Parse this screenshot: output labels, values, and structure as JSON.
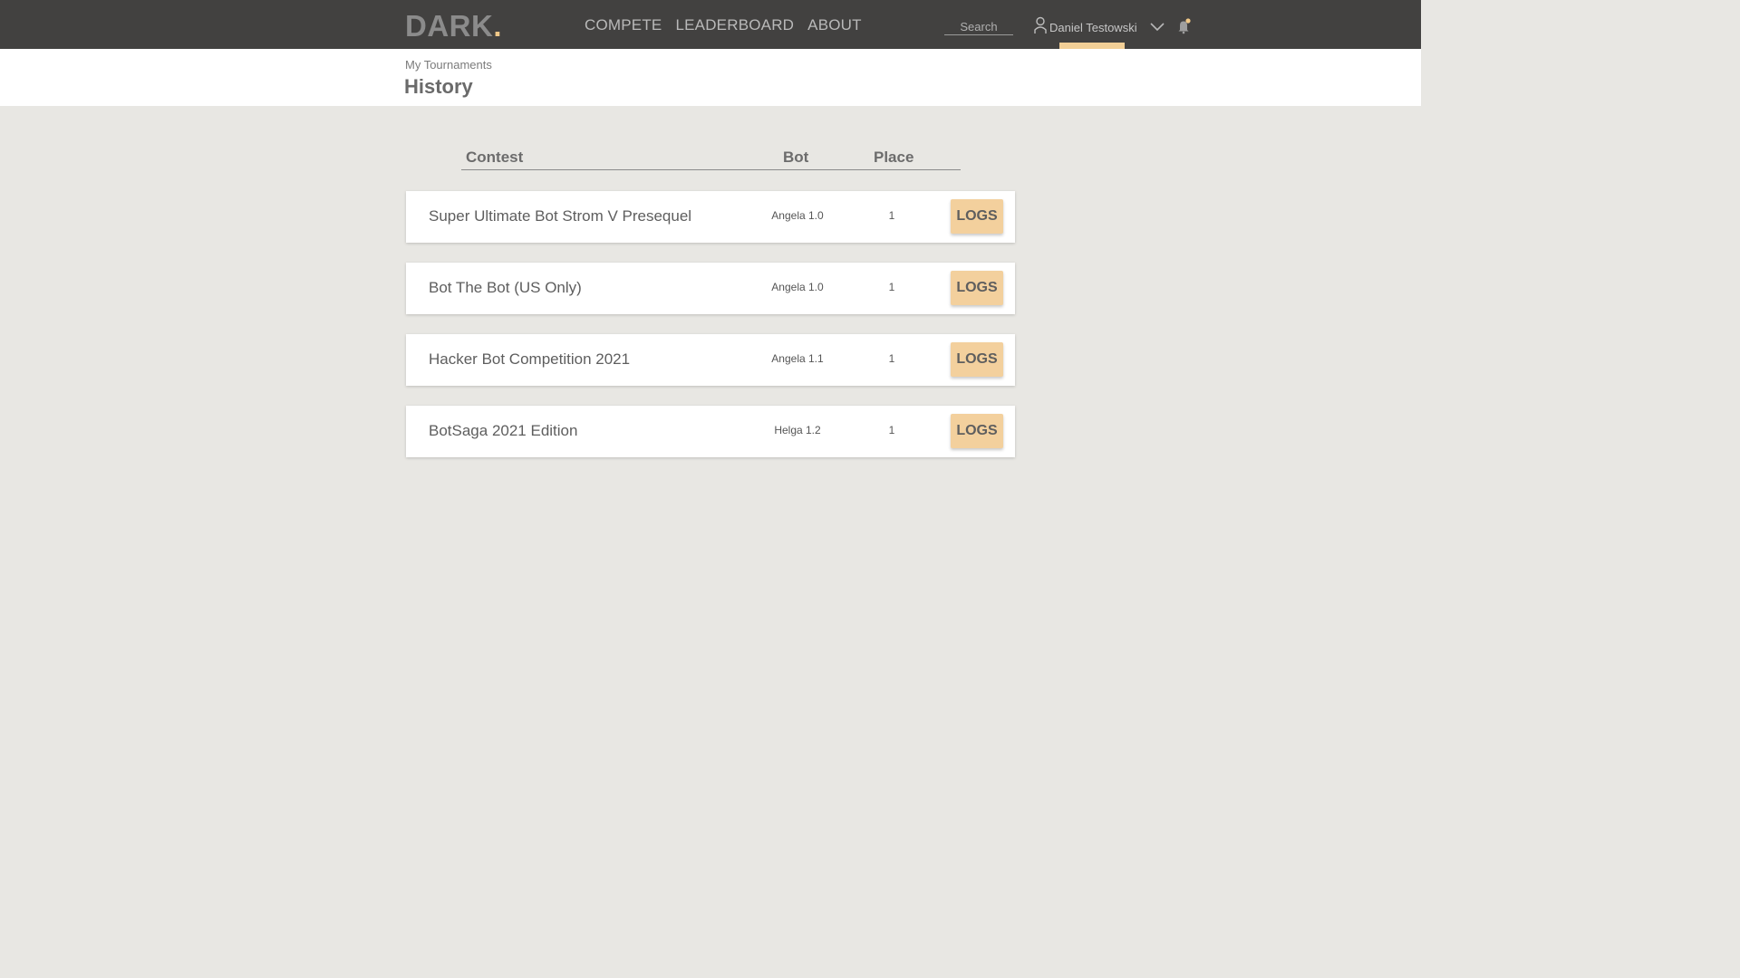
{
  "header": {
    "logo_text": "DARK",
    "logo_dot": ".",
    "nav": [
      {
        "label": "COMPETE"
      },
      {
        "label": "LEADERBOARD"
      },
      {
        "label": "ABOUT"
      }
    ],
    "search_placeholder": "Search",
    "user_name": "Daniel Testowski",
    "accent_color": "#f2cf96",
    "icons": [
      "user-icon",
      "chevron-down-icon",
      "bell-icon"
    ]
  },
  "page": {
    "breadcrumb": "My Tournaments",
    "title": "History"
  },
  "table": {
    "columns": {
      "contest": "Contest",
      "bot": "Bot",
      "place": "Place"
    },
    "rows": [
      {
        "contest": "Super Ultimate Bot Strom V Presequel",
        "bot": "Angela 1.0",
        "place": "1",
        "action": "LOGS"
      },
      {
        "contest": "Bot The Bot (US Only)",
        "bot": "Angela 1.0",
        "place": "1",
        "action": "LOGS"
      },
      {
        "contest": "Hacker Bot Competition 2021",
        "bot": "Angela 1.1",
        "place": "1",
        "action": "LOGS"
      },
      {
        "contest": "BotSaga 2021 Edition",
        "bot": "Helga 1.2",
        "place": "1",
        "action": "LOGS"
      }
    ]
  }
}
